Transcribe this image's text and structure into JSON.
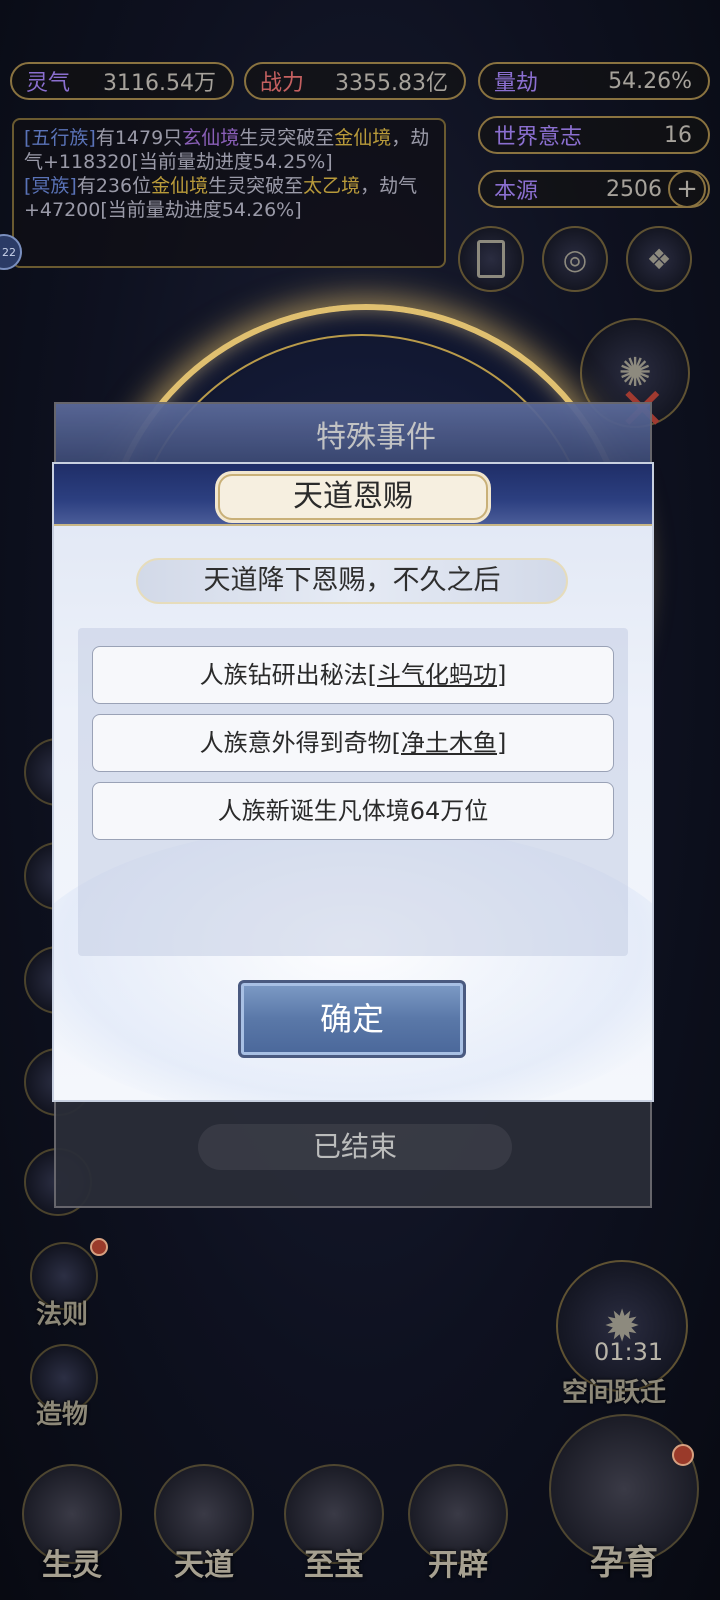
{
  "stats": {
    "lingqi_label": "灵气",
    "lingqi_value": "3116.54万",
    "zhanli_label": "战力",
    "zhanli_value": "3355.83亿",
    "liangjie_label": "量劫",
    "liangjie_value": "54.26%",
    "world_will_label": "世界意志",
    "world_will_value": "16",
    "benyuan_label": "本源",
    "benyuan_value": "2506",
    "plus_symbol": "+"
  },
  "log": {
    "l1_tag": "[五行族]",
    "l1_a": "有1479只",
    "l1_realm": "玄仙境",
    "l1_b": "生灵突破至",
    "l1_target": "金仙境",
    "l1_c": "，劫气+118320[当前量劫进度54.25%]",
    "l2_tag": "[冥族]",
    "l2_a": "有236位",
    "l2_realm": "金仙境",
    "l2_b": "生灵突破至",
    "l2_target": "太乙境",
    "l2_c": "，劫气+47200[当前量劫进度54.26%]",
    "left_badge": "22"
  },
  "side": {
    "fa_ze": "法则",
    "zao_wu": "造物",
    "space_jump": "空间跃迁",
    "countdown": "01:31"
  },
  "bottom_nav": {
    "shengling": "生灵",
    "tiandao": "天道",
    "zhibao": "至宝",
    "kaipi": "开辟",
    "yunyu": "孕育"
  },
  "back_dialog": {
    "title": "特殊事件",
    "ended_label": "已结束"
  },
  "dialog": {
    "title": "天道恩赐",
    "subtitle": "天道降下恩赐，不久之后",
    "items": [
      {
        "prefix": "人族钻研出秘法",
        "link": "[斗气化蚂功]"
      },
      {
        "prefix": "人族意外得到奇物",
        "link": "[净土木鱼]"
      },
      {
        "prefix": "人族新诞生凡体境64万位",
        "link": ""
      }
    ],
    "confirm": "确定"
  }
}
